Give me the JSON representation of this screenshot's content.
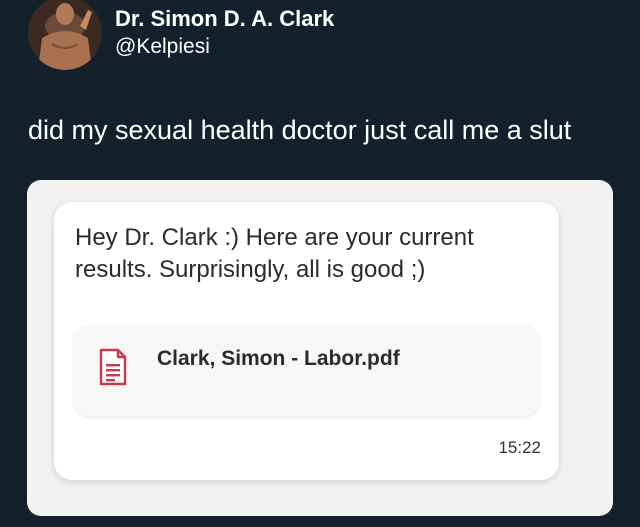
{
  "tweet": {
    "author": {
      "display_name": "Dr. Simon D. A. Clark",
      "handle": "@Kelpiesi"
    },
    "text": "did my sexual health doctor just call me a slut"
  },
  "message": {
    "text": "Hey Dr. Clark :) Here are your current results. Surprisingly, all is good ;)",
    "attachment": {
      "file_name": "Clark, Simon - Labor.pdf",
      "icon": "pdf-document-icon"
    },
    "timestamp": "15:22"
  },
  "colors": {
    "background": "#14202b",
    "card": "#ffffff",
    "icon_accent": "#c73a4d"
  }
}
